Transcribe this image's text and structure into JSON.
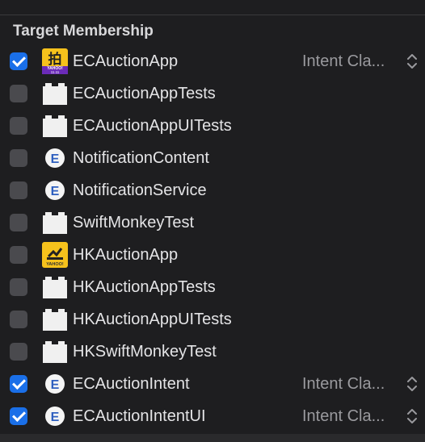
{
  "section": {
    "title": "Target Membership"
  },
  "targets": [
    {
      "name": "ECAuctionApp",
      "checked": true,
      "icon": "app-icon-yahoo-1111",
      "role": "Intent Cla..."
    },
    {
      "name": "ECAuctionAppTests",
      "checked": false,
      "icon": "bundle-icon",
      "role": ""
    },
    {
      "name": "ECAuctionAppUITests",
      "checked": false,
      "icon": "bundle-icon",
      "role": ""
    },
    {
      "name": "NotificationContent",
      "checked": false,
      "icon": "extension-icon",
      "role": ""
    },
    {
      "name": "NotificationService",
      "checked": false,
      "icon": "extension-icon",
      "role": ""
    },
    {
      "name": "SwiftMonkeyTest",
      "checked": false,
      "icon": "bundle-icon",
      "role": ""
    },
    {
      "name": "HKAuctionApp",
      "checked": false,
      "icon": "app-icon-yahoo-hk",
      "role": ""
    },
    {
      "name": "HKAuctionAppTests",
      "checked": false,
      "icon": "bundle-icon",
      "role": ""
    },
    {
      "name": "HKAuctionAppUITests",
      "checked": false,
      "icon": "bundle-icon",
      "role": ""
    },
    {
      "name": "HKSwiftMonkeyTest",
      "checked": false,
      "icon": "bundle-icon",
      "role": ""
    },
    {
      "name": "ECAuctionIntent",
      "checked": true,
      "icon": "extension-icon",
      "role": "Intent Cla..."
    },
    {
      "name": "ECAuctionIntentUI",
      "checked": true,
      "icon": "extension-icon",
      "role": "Intent Cla..."
    }
  ],
  "icon_text": {
    "yahoo_big": "拍",
    "yahoo_small": "YAHOO!",
    "yahoo_date": "11.11",
    "extension_letter": "E"
  },
  "colors": {
    "background": "#1e1e20",
    "checkbox_checked": "#1a6fe8",
    "checkbox_unchecked": "#4a4a4e"
  }
}
